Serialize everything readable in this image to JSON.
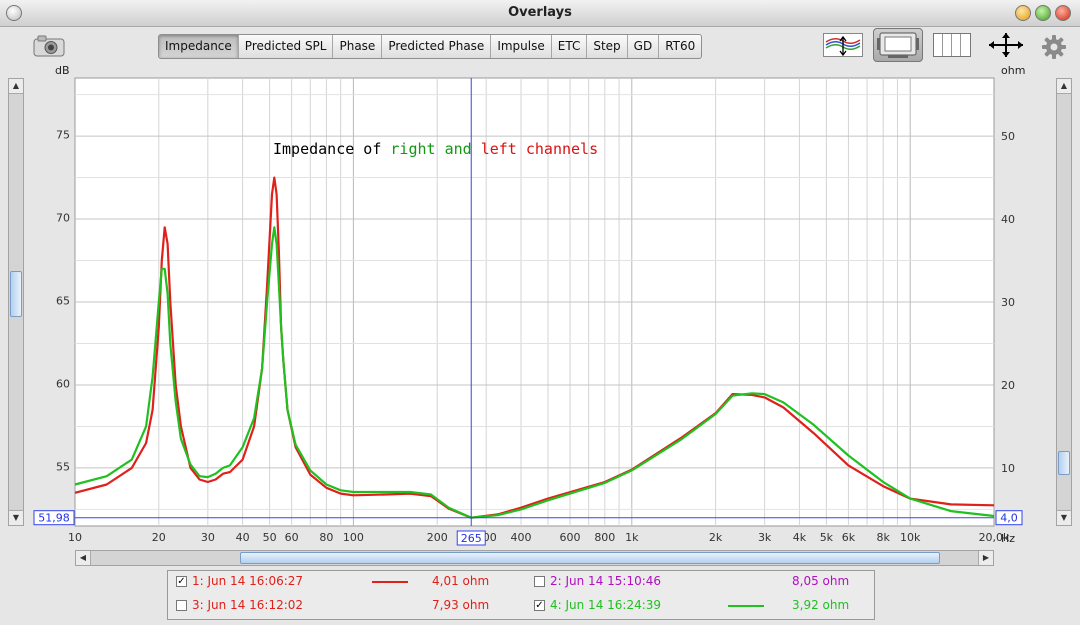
{
  "window": {
    "title": "Overlays"
  },
  "tabs": [
    {
      "label": "Impedance",
      "active": true
    },
    {
      "label": "Predicted SPL",
      "active": false
    },
    {
      "label": "Phase",
      "active": false
    },
    {
      "label": "Predicted Phase",
      "active": false
    },
    {
      "label": "Impulse",
      "active": false
    },
    {
      "label": "ETC",
      "active": false
    },
    {
      "label": "Step",
      "active": false
    },
    {
      "label": "GD",
      "active": false
    },
    {
      "label": "RT60",
      "active": false
    }
  ],
  "toolbar": {
    "icons": [
      "camera-icon",
      "trace-arrange-icon",
      "window-layout-icon",
      "columns-icon",
      "move-arrows-icon",
      "gear-icon"
    ]
  },
  "axes": {
    "left_unit": "dB",
    "right_unit": "ohm",
    "x_unit": "Hz"
  },
  "cursor": {
    "left_readout": "51,98",
    "right_readout": "4,0",
    "x_readout": "265"
  },
  "legend": [
    {
      "label": "1: Jun 14 16:06:27",
      "value": "4,01 ohm",
      "color": "#e0201a",
      "checked": true,
      "line": true
    },
    {
      "label": "2: Jun 14 15:10:46",
      "value": "8,05 ohm",
      "color": "#b010c0",
      "checked": false,
      "line": false
    },
    {
      "label": "3: Jun 14 16:12:02",
      "value": "7,93 ohm",
      "color": "#e0201a",
      "checked": false,
      "line": false
    },
    {
      "label": "4: Jun 14 16:24:39",
      "value": "3,92 ohm",
      "color": "#20c020",
      "checked": true,
      "line": true
    }
  ],
  "chart_data": {
    "type": "line",
    "annotation": [
      {
        "text": "Impedance of ",
        "color": "#000000"
      },
      {
        "text": "right",
        "color": "#119911"
      },
      {
        "text": " and ",
        "color": "#119911"
      },
      {
        "text": "left channels",
        "color": "#dd1111"
      }
    ],
    "x_scale": "log",
    "xlim": [
      10,
      20000
    ],
    "x_ticks": [
      10,
      20,
      30,
      40,
      50,
      60,
      80,
      100,
      200,
      300,
      400,
      600,
      800,
      1000,
      2000,
      3000,
      4000,
      5000,
      6000,
      8000,
      10000,
      20000
    ],
    "x_tick_labels": [
      "10",
      "20",
      "30",
      "40",
      "50",
      "60",
      "80",
      "100",
      "200",
      "300",
      "400",
      "600",
      "800",
      "1k",
      "2k",
      "3k",
      "4k",
      "5k",
      "6k",
      "8k",
      "10k",
      "20,0k"
    ],
    "y_left_ticks": [
      55,
      60,
      65,
      70,
      75
    ],
    "y_right_ticks": [
      10,
      20,
      30,
      40,
      50
    ],
    "ylim_right": [
      3.0,
      57.0
    ],
    "ylim_left": [
      51.4,
      78.4
    ],
    "grid": true,
    "cursor_x": 265,
    "cursor_y_ohm": 4.0,
    "series": [
      {
        "color": "#e0201a",
        "points": [
          [
            10,
            7
          ],
          [
            13,
            8
          ],
          [
            16,
            10
          ],
          [
            18,
            13
          ],
          [
            19,
            17
          ],
          [
            20,
            27
          ],
          [
            20.5,
            35
          ],
          [
            21,
            39
          ],
          [
            21.5,
            37
          ],
          [
            22,
            30
          ],
          [
            23,
            20
          ],
          [
            24,
            15
          ],
          [
            26,
            10
          ],
          [
            28,
            8.6
          ],
          [
            30,
            8.3
          ],
          [
            32,
            8.6
          ],
          [
            34,
            9.3
          ],
          [
            36,
            9.5
          ],
          [
            40,
            11
          ],
          [
            44,
            15
          ],
          [
            47,
            22
          ],
          [
            49,
            32
          ],
          [
            51,
            43
          ],
          [
            52,
            45
          ],
          [
            53,
            43
          ],
          [
            54,
            36
          ],
          [
            55,
            27
          ],
          [
            56,
            23
          ],
          [
            58,
            17
          ],
          [
            62,
            12.5
          ],
          [
            70,
            9.2
          ],
          [
            80,
            7.6
          ],
          [
            90,
            6.9
          ],
          [
            100,
            6.7
          ],
          [
            130,
            6.8
          ],
          [
            160,
            6.9
          ],
          [
            190,
            6.6
          ],
          [
            220,
            5.1
          ],
          [
            265,
            4.0
          ],
          [
            330,
            4.4
          ],
          [
            400,
            5.2
          ],
          [
            500,
            6.3
          ],
          [
            800,
            8.3
          ],
          [
            1000,
            9.8
          ],
          [
            1500,
            13.6
          ],
          [
            2000,
            16.6
          ],
          [
            2300,
            18.9
          ],
          [
            2700,
            18.8
          ],
          [
            3000,
            18.5
          ],
          [
            3500,
            17.3
          ],
          [
            4500,
            14.2
          ],
          [
            6000,
            10.3
          ],
          [
            8000,
            7.8
          ],
          [
            10000,
            6.3
          ],
          [
            14000,
            5.6
          ],
          [
            20000,
            5.5
          ]
        ]
      },
      {
        "color": "#20c020",
        "points": [
          [
            10,
            8
          ],
          [
            13,
            9
          ],
          [
            16,
            11
          ],
          [
            18,
            15
          ],
          [
            19,
            21
          ],
          [
            20,
            30
          ],
          [
            20.5,
            34
          ],
          [
            21,
            34
          ],
          [
            21.5,
            31
          ],
          [
            22,
            25
          ],
          [
            23,
            18
          ],
          [
            24,
            13.5
          ],
          [
            26,
            10.4
          ],
          [
            28,
            9
          ],
          [
            30,
            8.9
          ],
          [
            32,
            9.3
          ],
          [
            34,
            10
          ],
          [
            36,
            10.3
          ],
          [
            40,
            12.5
          ],
          [
            44,
            16
          ],
          [
            47,
            22
          ],
          [
            49,
            30
          ],
          [
            51,
            37
          ],
          [
            52,
            39
          ],
          [
            53,
            37
          ],
          [
            54,
            32
          ],
          [
            55,
            27
          ],
          [
            56,
            23
          ],
          [
            58,
            17
          ],
          [
            62,
            12.8
          ],
          [
            70,
            9.7
          ],
          [
            80,
            8
          ],
          [
            90,
            7.3
          ],
          [
            100,
            7.1
          ],
          [
            130,
            7.1
          ],
          [
            160,
            7.1
          ],
          [
            190,
            6.8
          ],
          [
            220,
            5.2
          ],
          [
            265,
            4.0
          ],
          [
            330,
            4.3
          ],
          [
            400,
            5.0
          ],
          [
            500,
            6.1
          ],
          [
            800,
            8.2
          ],
          [
            1000,
            9.7
          ],
          [
            1500,
            13.4
          ],
          [
            2000,
            16.5
          ],
          [
            2300,
            18.7
          ],
          [
            2700,
            19
          ],
          [
            3000,
            18.9
          ],
          [
            3500,
            17.9
          ],
          [
            4500,
            15.2
          ],
          [
            6000,
            11.5
          ],
          [
            8000,
            8.3
          ],
          [
            10000,
            6.3
          ],
          [
            14000,
            4.8
          ],
          [
            20000,
            4.2
          ]
        ]
      }
    ]
  }
}
